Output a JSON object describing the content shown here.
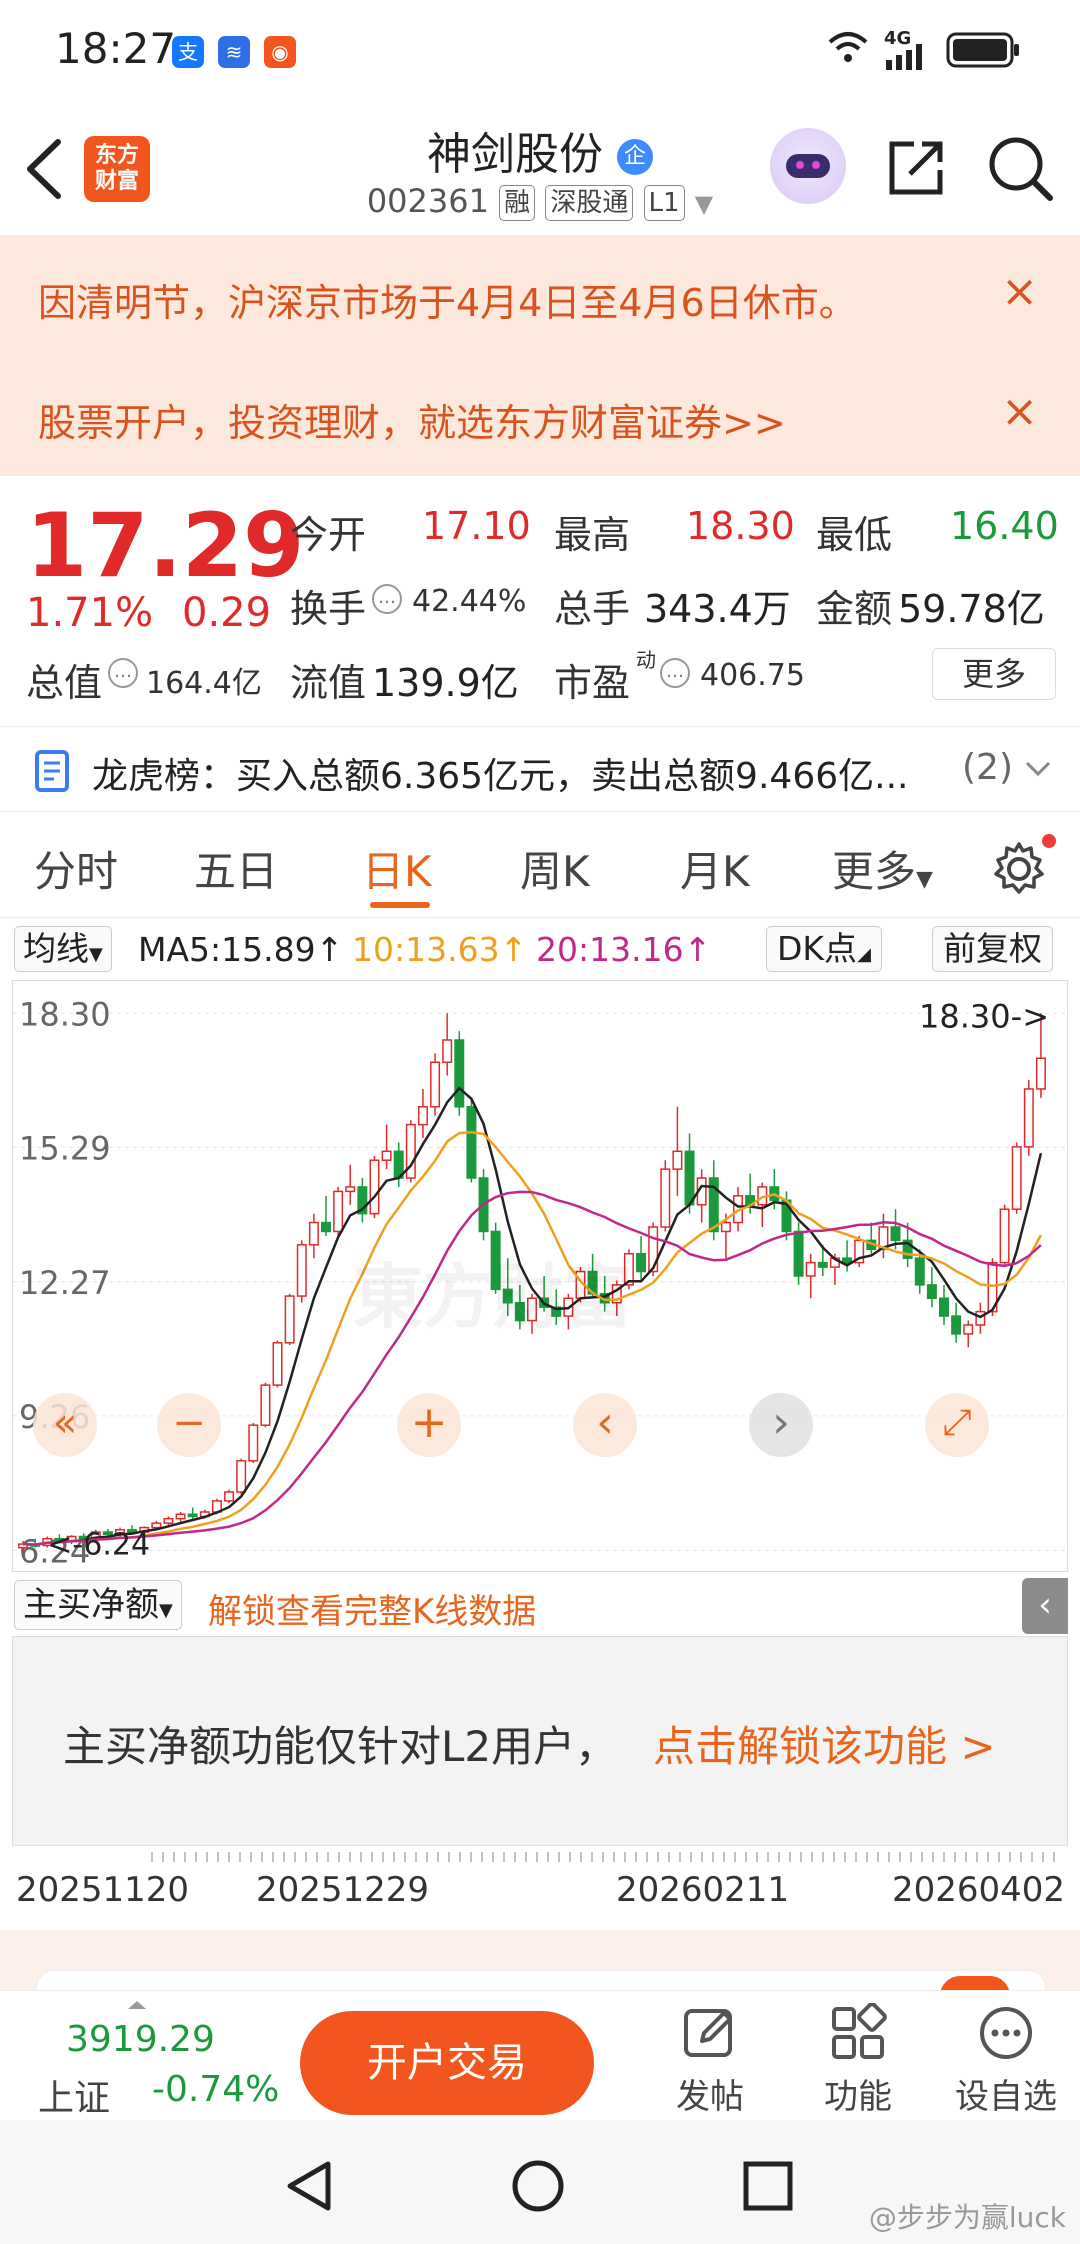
{
  "status_bar": {
    "time": "18:27",
    "signal": "4G"
  },
  "header": {
    "logo_line1": "东方",
    "logo_line2": "财富",
    "stock_name": "神剑股份",
    "enterprise_badge": "企",
    "stock_code": "002361",
    "tags": [
      "融",
      "深股通",
      "L1"
    ]
  },
  "notices": [
    {
      "text": "因清明节，沪深京市场于4月4日至4月6日休市。",
      "close": "×"
    },
    {
      "text": "股票开户，投资理财，就选东方财富证券>>",
      "close": "×"
    }
  ],
  "quote": {
    "price": "17.29",
    "change_pct": "1.71%",
    "change": "0.29",
    "open_label": "今开",
    "open": "17.10",
    "high_label": "最高",
    "high": "18.30",
    "low_label": "最低",
    "low": "16.40",
    "turnover_label": "换手",
    "turnover": "42.44%",
    "volume_label": "总手",
    "volume": "343.4万",
    "amount_label": "金额",
    "amount": "59.78亿",
    "total_value_label": "总值",
    "total_value": "164.4亿",
    "float_value_label": "流值",
    "float_value": "139.9亿",
    "pe_label": "市盈",
    "pe_sup": "动",
    "pe": "406.75",
    "more": "更多"
  },
  "dragon_tiger": {
    "text": "龙虎榜：买入总额6.365亿元，卖出总额9.466亿...",
    "count": "(2)"
  },
  "tabs": [
    "分时",
    "五日",
    "日K",
    "周K",
    "月K",
    "更多"
  ],
  "active_tab": "日K",
  "ma_row": {
    "selector": "均线",
    "ma5": "MA5:15.89↑",
    "ma10": "10:13.63↑",
    "ma20": "20:13.16↑",
    "dk": "DK点",
    "adjust": "前复权"
  },
  "chart_data": {
    "type": "candlestick",
    "y_ticks": [
      "18.30",
      "15.29",
      "12.27",
      "9.26",
      "6.24"
    ],
    "ylim": [
      6.0,
      18.8
    ],
    "high_marker": "18.30->",
    "low_marker": "<-6.24",
    "x_ticks": [
      "20251120",
      "20251229",
      "20260211",
      "20260402"
    ],
    "colors": {
      "up": "#e02a2a",
      "down": "#1a9a3c",
      "ma5": "#222222",
      "ma10": "#f0a01e",
      "ma20": "#c0288a"
    },
    "candles": [
      [
        6.3,
        6.45,
        6.22,
        6.38
      ],
      [
        6.38,
        6.5,
        6.3,
        6.35
      ],
      [
        6.35,
        6.55,
        6.3,
        6.5
      ],
      [
        6.5,
        6.6,
        6.4,
        6.45
      ],
      [
        6.45,
        6.58,
        6.38,
        6.55
      ],
      [
        6.55,
        6.62,
        6.45,
        6.48
      ],
      [
        6.48,
        6.7,
        6.45,
        6.65
      ],
      [
        6.65,
        6.72,
        6.55,
        6.6
      ],
      [
        6.6,
        6.75,
        6.55,
        6.7
      ],
      [
        6.7,
        6.8,
        6.6,
        6.65
      ],
      [
        6.65,
        6.78,
        6.6,
        6.75
      ],
      [
        6.75,
        6.9,
        6.7,
        6.85
      ],
      [
        6.85,
        7.0,
        6.8,
        6.95
      ],
      [
        6.95,
        7.1,
        6.88,
        7.05
      ],
      [
        7.05,
        7.2,
        6.95,
        7.0
      ],
      [
        7.0,
        7.15,
        6.95,
        7.1
      ],
      [
        7.1,
        7.4,
        7.05,
        7.35
      ],
      [
        7.35,
        7.6,
        7.3,
        7.55
      ],
      [
        7.55,
        8.3,
        7.5,
        8.25
      ],
      [
        8.25,
        9.1,
        8.2,
        9.05
      ],
      [
        9.05,
        10.0,
        9.0,
        9.95
      ],
      [
        9.95,
        10.95,
        9.9,
        10.9
      ],
      [
        10.9,
        12.0,
        10.85,
        11.95
      ],
      [
        11.95,
        13.2,
        11.8,
        13.1
      ],
      [
        13.1,
        13.8,
        12.8,
        13.6
      ],
      [
        13.6,
        14.2,
        13.3,
        13.4
      ],
      [
        13.4,
        14.4,
        13.3,
        14.3
      ],
      [
        14.3,
        14.9,
        14.0,
        14.4
      ],
      [
        14.4,
        14.6,
        13.6,
        13.8
      ],
      [
        13.8,
        15.1,
        13.7,
        15.0
      ],
      [
        15.0,
        15.8,
        14.8,
        15.2
      ],
      [
        15.2,
        15.4,
        14.4,
        14.6
      ],
      [
        14.6,
        15.9,
        14.5,
        15.8
      ],
      [
        15.8,
        16.6,
        15.5,
        16.2
      ],
      [
        16.2,
        17.4,
        16.0,
        17.2
      ],
      [
        17.2,
        18.3,
        16.9,
        17.7
      ],
      [
        17.7,
        17.9,
        16.0,
        16.2
      ],
      [
        16.2,
        16.4,
        14.5,
        14.6
      ],
      [
        14.6,
        14.8,
        13.2,
        13.4
      ],
      [
        13.4,
        13.6,
        12.0,
        12.1
      ],
      [
        12.1,
        12.8,
        11.5,
        11.8
      ],
      [
        11.8,
        12.2,
        11.2,
        11.4
      ],
      [
        11.4,
        12.0,
        11.1,
        11.9
      ],
      [
        11.9,
        12.4,
        11.6,
        11.7
      ],
      [
        11.7,
        12.1,
        11.3,
        11.5
      ],
      [
        11.5,
        12.0,
        11.2,
        11.9
      ],
      [
        11.9,
        12.6,
        11.8,
        12.5
      ],
      [
        12.5,
        12.9,
        11.9,
        12.0
      ],
      [
        12.0,
        12.4,
        11.6,
        11.8
      ],
      [
        11.8,
        12.3,
        11.5,
        12.2
      ],
      [
        12.2,
        13.0,
        12.1,
        12.9
      ],
      [
        12.9,
        13.3,
        12.3,
        12.5
      ],
      [
        12.5,
        13.6,
        12.4,
        13.5
      ],
      [
        13.5,
        15.0,
        13.4,
        14.8
      ],
      [
        14.8,
        16.2,
        14.2,
        15.2
      ],
      [
        15.2,
        15.6,
        13.8,
        14.0
      ],
      [
        14.0,
        14.8,
        13.6,
        14.6
      ],
      [
        14.6,
        15.0,
        13.2,
        13.4
      ],
      [
        13.4,
        13.8,
        12.8,
        13.6
      ],
      [
        13.6,
        14.4,
        13.4,
        14.2
      ],
      [
        14.2,
        14.7,
        13.8,
        14.0
      ],
      [
        14.0,
        14.5,
        13.5,
        14.4
      ],
      [
        14.4,
        14.8,
        13.9,
        14.1
      ],
      [
        14.1,
        14.3,
        13.2,
        13.4
      ],
      [
        13.4,
        13.6,
        12.2,
        12.4
      ],
      [
        12.4,
        12.9,
        11.9,
        12.7
      ],
      [
        12.7,
        13.1,
        12.4,
        12.6
      ],
      [
        12.6,
        12.9,
        12.2,
        12.8
      ],
      [
        12.8,
        13.2,
        12.5,
        12.7
      ],
      [
        12.7,
        13.3,
        12.6,
        13.2
      ],
      [
        13.2,
        13.6,
        12.9,
        13.0
      ],
      [
        13.0,
        13.8,
        12.8,
        13.5
      ],
      [
        13.5,
        13.9,
        13.0,
        13.2
      ],
      [
        13.2,
        13.6,
        12.6,
        12.8
      ],
      [
        12.8,
        13.0,
        12.0,
        12.2
      ],
      [
        12.2,
        12.6,
        11.7,
        11.9
      ],
      [
        11.9,
        12.2,
        11.3,
        11.5
      ],
      [
        11.5,
        11.8,
        10.9,
        11.1
      ],
      [
        11.1,
        11.4,
        10.8,
        11.3
      ],
      [
        11.3,
        11.8,
        11.1,
        11.6
      ],
      [
        11.6,
        12.8,
        11.5,
        12.7
      ],
      [
        12.7,
        14.0,
        12.6,
        13.9
      ],
      [
        13.9,
        15.4,
        13.8,
        15.3
      ],
      [
        15.3,
        16.8,
        15.1,
        16.6
      ],
      [
        16.6,
        18.3,
        16.4,
        17.29
      ]
    ]
  },
  "chart_controls": [
    "«",
    "+",
    "‹",
    "›",
    "⤢"
  ],
  "indicator": {
    "selector": "主买净额",
    "unlock": "解锁查看完整K线数据"
  },
  "l2_panel": {
    "text": "主买净额功能仅针对L2用户，",
    "link": "点击解锁该功能 >"
  },
  "index": {
    "value": "3919.29",
    "name": "上证",
    "change": "-0.74%"
  },
  "bottom_bar": {
    "trade": "开户交易",
    "post": "发帖",
    "function": "功能",
    "watchlist": "设自选"
  },
  "watermark": "@步步为赢luck"
}
